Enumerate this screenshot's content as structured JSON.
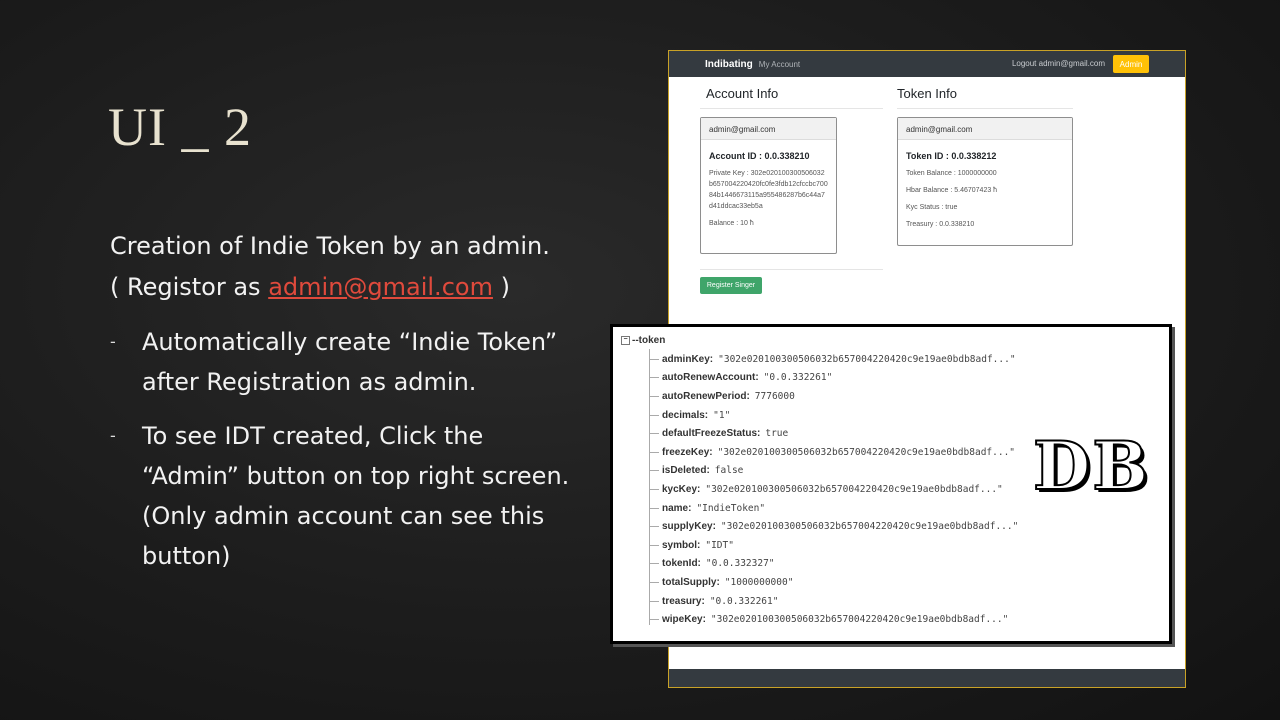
{
  "slide": {
    "title": "UI _ 2",
    "intro_line1": "Creation of Indie Token by an admin.",
    "intro_line2_prefix": "( Registor as ",
    "intro_link": "admin@gmail.com",
    "intro_line2_suffix": " )",
    "bullets": [
      {
        "dash": "-",
        "text": "Automatically create “Indie Token” after Registration as admin."
      },
      {
        "dash": "-",
        "text": "To see IDT created, Click the “Admin” button on top right screen.(Only admin account can see this  button)"
      }
    ]
  },
  "app": {
    "brand": "Indibating",
    "nav_my_account": "My Account",
    "logout": "Logout admin@gmail.com",
    "admin_button": "Admin",
    "account_info": {
      "heading": "Account Info",
      "email": "admin@gmail.com",
      "account_id": "Account ID : 0.0.338210",
      "private_key": "Private Key : 302e020100300506032b657004220420fc0fe3fdb12cfccbc70084b1446673115a955486287b6c44a7d41ddcac33eb5a",
      "balance": "Balance : 10 ħ"
    },
    "token_info": {
      "heading": "Token Info",
      "email": "admin@gmail.com",
      "token_id": "Token ID : 0.0.338212",
      "token_balance": "Token Balance : 1000000000",
      "hbar_balance": "Hbar Balance : 5.46707423 ħ",
      "kyc_status": "Kyc Status : true",
      "treasury": "Treasury : 0.0.338210"
    },
    "register_button": "Register Singer"
  },
  "db": {
    "root": "token",
    "label": "DB",
    "fields": [
      {
        "key": "adminKey:",
        "value": "\"302e020100300506032b657004220420c9e19ae0bdb8adf...\""
      },
      {
        "key": "autoRenewAccount:",
        "value": "\"0.0.332261\""
      },
      {
        "key": "autoRenewPeriod:",
        "value": "7776000"
      },
      {
        "key": "decimals:",
        "value": "\"1\""
      },
      {
        "key": "defaultFreezeStatus:",
        "value": "true"
      },
      {
        "key": "freezeKey:",
        "value": "\"302e020100300506032b657004220420c9e19ae0bdb8adf...\""
      },
      {
        "key": "isDeleted:",
        "value": "false"
      },
      {
        "key": "kycKey:",
        "value": "\"302e020100300506032b657004220420c9e19ae0bdb8adf...\""
      },
      {
        "key": "name:",
        "value": "\"IndieToken\""
      },
      {
        "key": "supplyKey:",
        "value": "\"302e020100300506032b657004220420c9e19ae0bdb8adf...\""
      },
      {
        "key": "symbol:",
        "value": "\"IDT\""
      },
      {
        "key": "tokenId:",
        "value": "\"0.0.332327\""
      },
      {
        "key": "totalSupply:",
        "value": "\"1000000000\""
      },
      {
        "key": "treasury:",
        "value": "\"0.0.332261\""
      },
      {
        "key": "wipeKey:",
        "value": "\"302e020100300506032b657004220420c9e19ae0bdb8adf...\""
      }
    ]
  },
  "colors": {
    "accent_link": "#e04a3c",
    "admin_button": "#ffc107",
    "register_button": "#3fa56a",
    "navbar": "#343a40"
  }
}
